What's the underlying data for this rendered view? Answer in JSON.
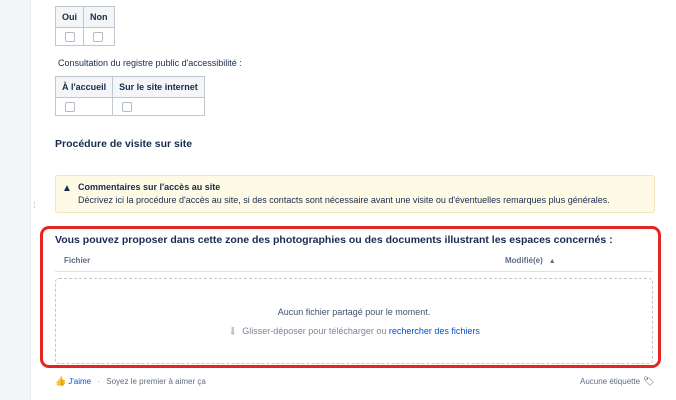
{
  "top_table": {
    "headers": [
      "Oui",
      "Non"
    ]
  },
  "consultation": {
    "caption": "Consultation du registre public d'accessibilité :",
    "headers": [
      "À l'accueil",
      "Sur le site internet"
    ]
  },
  "procedure": {
    "heading": "Procédure de visite sur site",
    "warning_title": "Commentaires sur l'accès au site",
    "warning_text": "Décrivez ici la procédure d'accès au site, si des contacts sont nécessaire avant une visite ou d'éventuelles remarques plus générales."
  },
  "attachments": {
    "title": "Vous pouvez proposer dans cette zone des photographies ou des documents illustrant les espaces concernés :",
    "col_file": "Fichier",
    "col_modified": "Modifié(e)",
    "empty_message": "Aucun fichier partagé pour le moment.",
    "drop_text": "Glisser-déposer pour télécharger ou",
    "browse_link": "rechercher des fichiers"
  },
  "footer": {
    "like": "J'aime",
    "first_like": "Soyez le premier à aimer ça",
    "labels": "Aucune étiquette"
  },
  "colors": {
    "highlight_border": "#e3261f",
    "link": "#0052cc",
    "warning_bg": "#fffae6"
  }
}
